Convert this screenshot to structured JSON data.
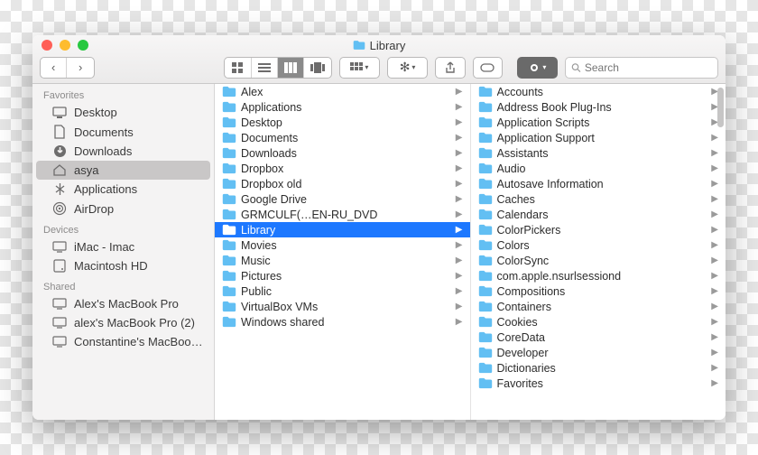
{
  "window": {
    "title": "Library"
  },
  "search": {
    "placeholder": "Search"
  },
  "sidebar": {
    "sections": [
      {
        "header": "Favorites",
        "items": [
          {
            "icon": "desktop",
            "label": "Desktop"
          },
          {
            "icon": "doc",
            "label": "Documents"
          },
          {
            "icon": "download",
            "label": "Downloads"
          },
          {
            "icon": "home",
            "label": "asya",
            "selected": true
          },
          {
            "icon": "apps",
            "label": "Applications"
          },
          {
            "icon": "airdrop",
            "label": "AirDrop"
          }
        ]
      },
      {
        "header": "Devices",
        "items": [
          {
            "icon": "monitor",
            "label": "iMac - Imac"
          },
          {
            "icon": "disk",
            "label": "Macintosh HD"
          }
        ]
      },
      {
        "header": "Shared",
        "items": [
          {
            "icon": "monitor",
            "label": "Alex's MacBook Pro"
          },
          {
            "icon": "monitor",
            "label": "alex's MacBook Pro (2)"
          },
          {
            "icon": "monitor",
            "label": "Constantine's MacBoo…"
          }
        ]
      }
    ]
  },
  "columns": [
    {
      "items": [
        {
          "name": "Alex",
          "hasChildren": true
        },
        {
          "name": "Applications",
          "hasChildren": true
        },
        {
          "name": "Desktop",
          "hasChildren": true
        },
        {
          "name": "Documents",
          "hasChildren": true
        },
        {
          "name": "Downloads",
          "hasChildren": true
        },
        {
          "name": "Dropbox",
          "hasChildren": true
        },
        {
          "name": "Dropbox old",
          "hasChildren": true
        },
        {
          "name": "Google Drive",
          "hasChildren": true
        },
        {
          "name": "GRMCULF(…EN-RU_DVD",
          "hasChildren": true
        },
        {
          "name": "Library",
          "hasChildren": true,
          "selected": true
        },
        {
          "name": "Movies",
          "hasChildren": true
        },
        {
          "name": "Music",
          "hasChildren": true
        },
        {
          "name": "Pictures",
          "hasChildren": true
        },
        {
          "name": "Public",
          "hasChildren": true
        },
        {
          "name": "VirtualBox VMs",
          "hasChildren": true
        },
        {
          "name": "Windows shared",
          "hasChildren": true
        }
      ]
    },
    {
      "items": [
        {
          "name": "Accounts",
          "hasChildren": true
        },
        {
          "name": "Address Book Plug-Ins",
          "hasChildren": true
        },
        {
          "name": "Application Scripts",
          "hasChildren": true
        },
        {
          "name": "Application Support",
          "hasChildren": true
        },
        {
          "name": "Assistants",
          "hasChildren": true
        },
        {
          "name": "Audio",
          "hasChildren": true
        },
        {
          "name": "Autosave Information",
          "hasChildren": true
        },
        {
          "name": "Caches",
          "hasChildren": true
        },
        {
          "name": "Calendars",
          "hasChildren": true
        },
        {
          "name": "ColorPickers",
          "hasChildren": true
        },
        {
          "name": "Colors",
          "hasChildren": true
        },
        {
          "name": "ColorSync",
          "hasChildren": true
        },
        {
          "name": "com.apple.nsurlsessiond",
          "hasChildren": true
        },
        {
          "name": "Compositions",
          "hasChildren": true
        },
        {
          "name": "Containers",
          "hasChildren": true
        },
        {
          "name": "Cookies",
          "hasChildren": true
        },
        {
          "name": "CoreData",
          "hasChildren": true
        },
        {
          "name": "Developer",
          "hasChildren": true
        },
        {
          "name": "Dictionaries",
          "hasChildren": true
        },
        {
          "name": "Favorites",
          "hasChildren": true
        }
      ]
    }
  ]
}
